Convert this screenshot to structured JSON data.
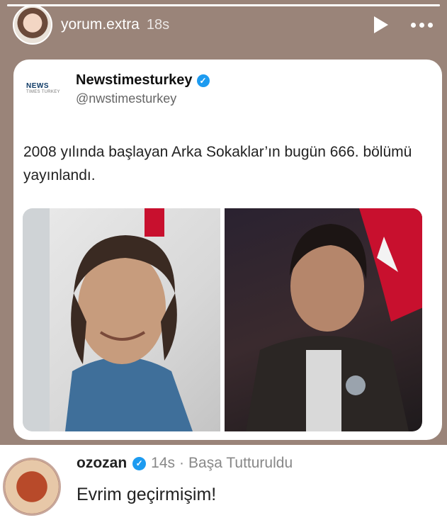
{
  "story": {
    "username": "yorum.extra",
    "time": "18s",
    "progress_fraction": 1.0,
    "icons": [
      "avatar",
      "play-icon",
      "more-icon"
    ]
  },
  "tweet": {
    "logo_top": "NEWS",
    "logo_bottom": "TIMES TURKEY",
    "display_name": "Newstimesturkey",
    "handle": "@nwstimesturkey",
    "text": "2008 yılında başlayan Arka Sokaklar’ın bugün 666. bölümü yayınlandı."
  },
  "comment": {
    "username": "ozozan",
    "time": "14s",
    "separator": "·",
    "pinned_label": "Başa Tutturuldu",
    "text": "Evrim geçirmişim!"
  },
  "colors": {
    "story_bg": "#9a8479",
    "verified_blue": "#1d9bf0",
    "flag_red": "#c8102e"
  }
}
